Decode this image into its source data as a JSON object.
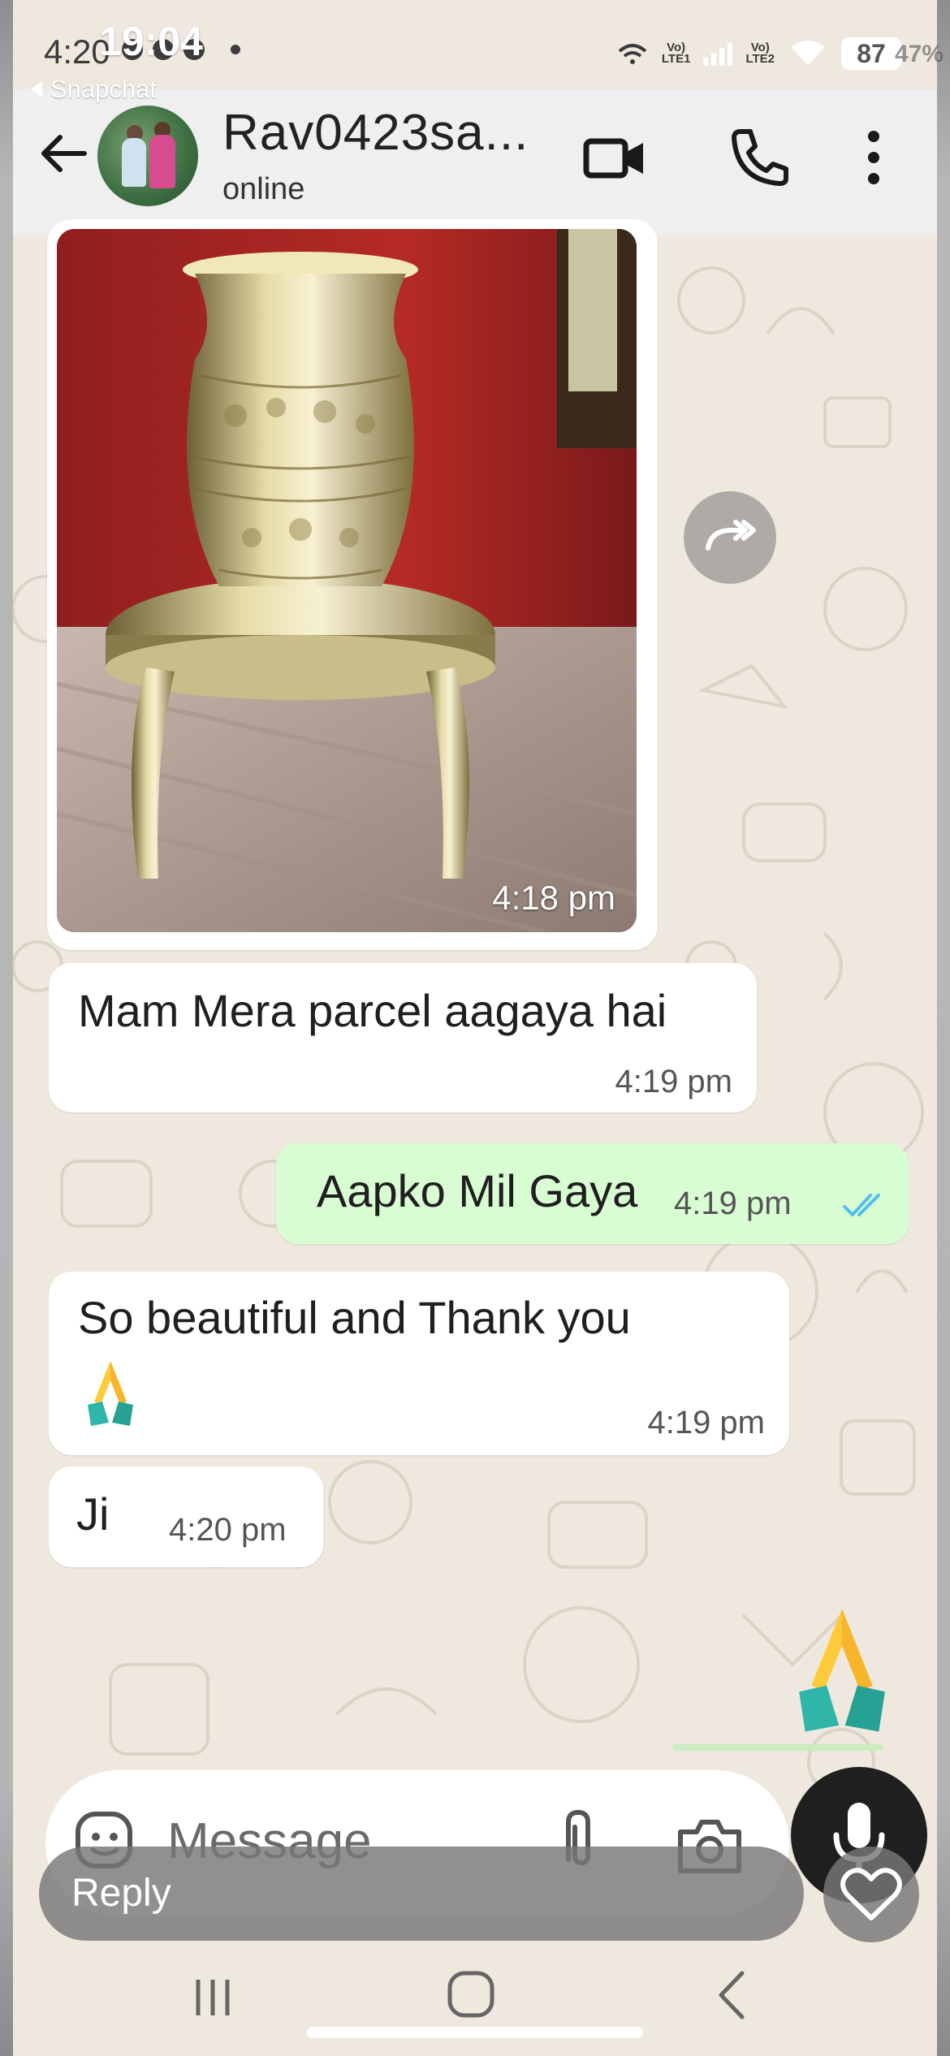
{
  "status_bar": {
    "ios_time": "19:04",
    "android_time": "4:20",
    "back_app": "Snapchat",
    "battery": "87",
    "battery_dim": "47%",
    "net1": "Vo)\nLTE1",
    "net2": "Vo)\nLTE2"
  },
  "header": {
    "contact_name": "Rav0423sa...",
    "contact_status": "online"
  },
  "messages": [
    {
      "id": "img",
      "direction": "in",
      "type": "image",
      "time": "4:18 pm"
    },
    {
      "id": "m1",
      "direction": "in",
      "text": "Mam Mera parcel aagaya hai",
      "time": "4:19 pm"
    },
    {
      "id": "m2",
      "direction": "out",
      "text": "Aapko Mil Gaya",
      "time": "4:19 pm",
      "status": "read"
    },
    {
      "id": "m3",
      "direction": "in",
      "text": "So beautiful and Thank you",
      "emoji": "folded-hands",
      "time": "4:19 pm"
    },
    {
      "id": "m4",
      "direction": "in",
      "text": "Ji",
      "time": "4:20 pm"
    },
    {
      "id": "m5",
      "direction": "out",
      "type": "sticker",
      "emoji": "folded-hands"
    }
  ],
  "composer": {
    "placeholder": "Message"
  },
  "overlay": {
    "reply_label": "Reply"
  },
  "colors": {
    "incoming": "#ffffff",
    "outgoing": "#d9fdd3",
    "read_ticks": "#53bdeb",
    "chat_bg": "#efe8df"
  },
  "icons": [
    "back-arrow-icon",
    "video-call-icon",
    "phone-icon",
    "more-vert-icon",
    "forward-icon",
    "emoji-icon",
    "attach-icon",
    "camera-icon",
    "mic-icon",
    "heart-icon",
    "double-check-icon"
  ]
}
